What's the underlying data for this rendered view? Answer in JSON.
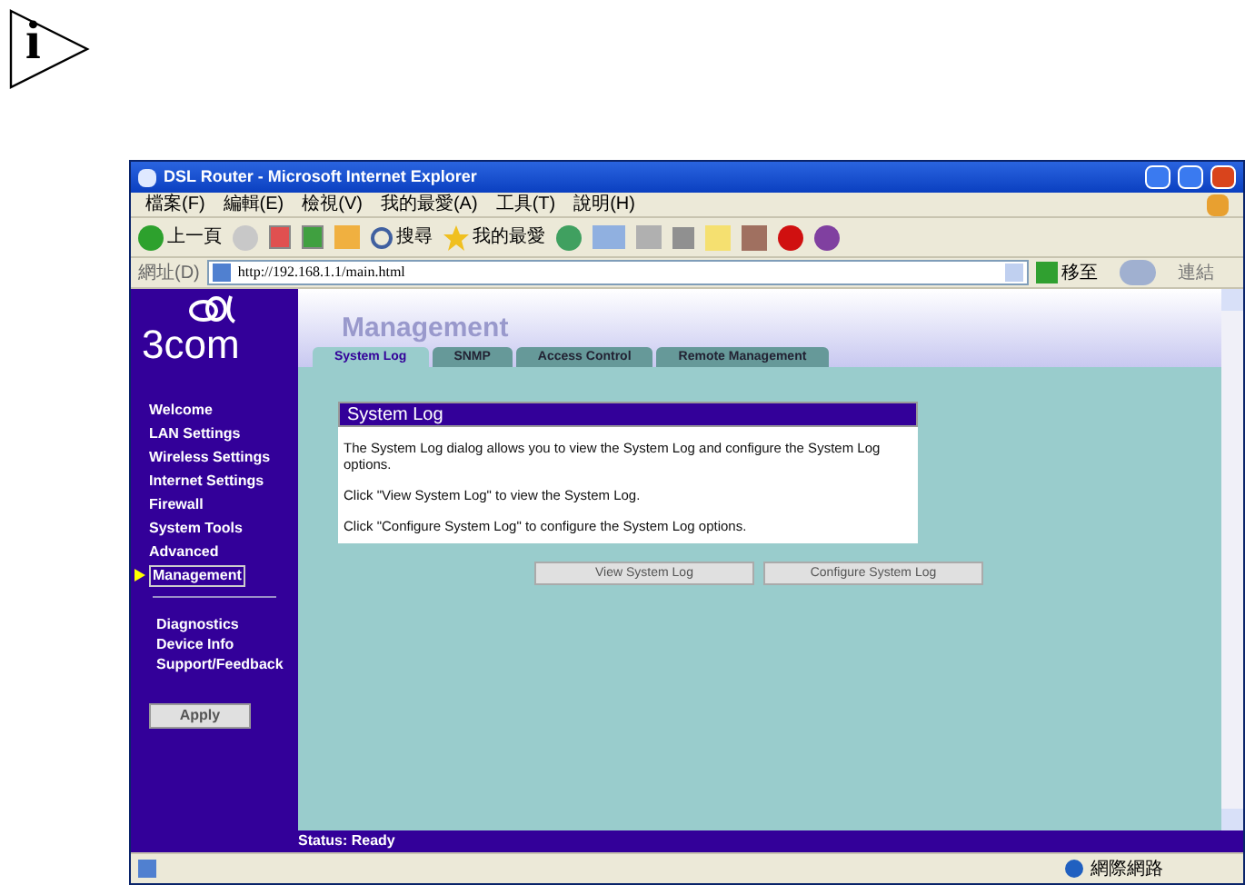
{
  "note_icon": {
    "letter": "i"
  },
  "window": {
    "title": "DSL Router - Microsoft Internet Explorer"
  },
  "menu": [
    "檔案(F)",
    "編輯(E)",
    "檢視(V)",
    "我的最愛(A)",
    "工具(T)",
    "說明(H)"
  ],
  "toolbar": {
    "back": "上一頁",
    "search": "搜尋",
    "favorites": "我的最愛"
  },
  "address_bar": {
    "label": "網址(D)",
    "value": "http://192.168.1.1/main.html",
    "go": "移至",
    "links": "連結"
  },
  "sidebar": {
    "logo": "3com",
    "items": [
      {
        "label": "Welcome",
        "selected": false
      },
      {
        "label": "LAN Settings",
        "selected": false
      },
      {
        "label": "Wireless Settings",
        "selected": false
      },
      {
        "label": "Internet Settings",
        "selected": false
      },
      {
        "label": "Firewall",
        "selected": false
      },
      {
        "label": "System Tools",
        "selected": false
      },
      {
        "label": "Advanced",
        "selected": false
      },
      {
        "label": "Management",
        "selected": true
      }
    ],
    "extra_items": [
      "Diagnostics",
      "Device Info",
      "Support/Feedback"
    ],
    "apply": "Apply"
  },
  "page": {
    "heading": "Management",
    "tabs": [
      {
        "label": "System Log",
        "selected": true
      },
      {
        "label": "SNMP",
        "selected": false
      },
      {
        "label": "Access Control",
        "selected": false
      },
      {
        "label": "Remote Management",
        "selected": false
      }
    ],
    "panel": {
      "title": "System Log",
      "paragraphs": [
        "The System Log dialog allows you to view the System Log and configure the System Log options.",
        "Click \"View System Log\" to view the System Log.",
        "Click \"Configure System Log\" to configure the System Log options."
      ]
    },
    "buttons": [
      "View System Log",
      "Configure System Log"
    ],
    "status": "Status: Ready"
  },
  "status_bar": {
    "zone": "網際網路"
  }
}
